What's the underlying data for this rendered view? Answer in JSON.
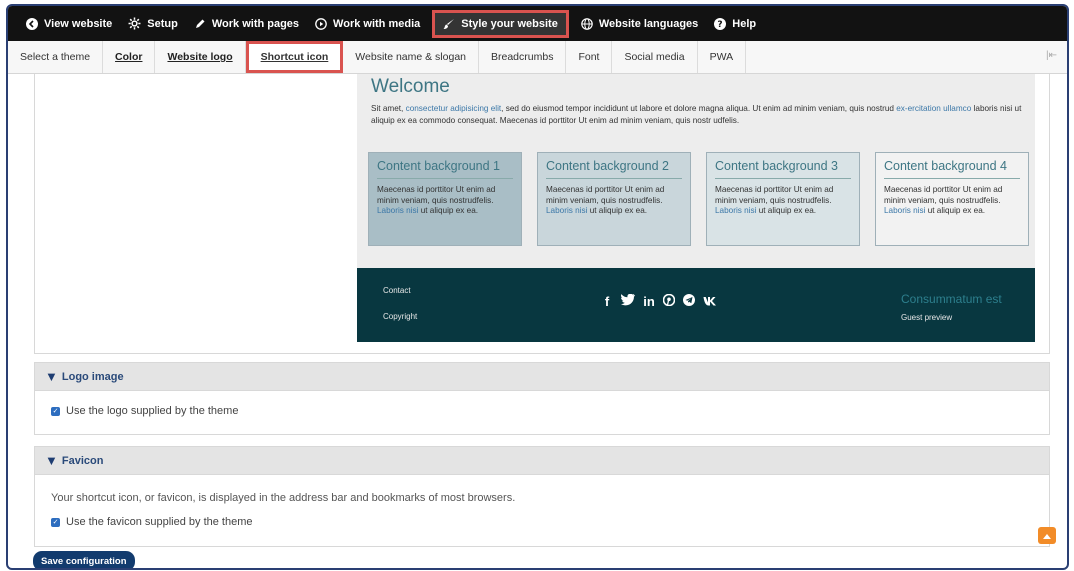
{
  "toolbar": {
    "items": [
      {
        "label": "View website",
        "icon": "arrow-circle-left-icon"
      },
      {
        "label": "Setup",
        "icon": "gear-icon"
      },
      {
        "label": "Work with pages",
        "icon": "pencil-icon"
      },
      {
        "label": "Work with media",
        "icon": "play-circle-icon"
      },
      {
        "label": "Style your website",
        "icon": "brush-icon"
      },
      {
        "label": "Website languages",
        "icon": "globe-icon"
      },
      {
        "label": "Help",
        "icon": "question-circle-icon"
      }
    ]
  },
  "tabs": {
    "items": [
      "Select a theme",
      "Color",
      "Website logo",
      "Shortcut icon",
      "Website name & slogan",
      "Breadcrumbs",
      "Font",
      "Social media",
      "PWA"
    ],
    "collapse_glyph": "|⇤"
  },
  "preview": {
    "title": "Welcome",
    "intro_a": "Sit amet, ",
    "intro_link1": "consectetur adipisicing elit",
    "intro_b": ", sed do eiusmod tempor incididunt ut labore et dolore magna aliqua. Ut enim ad minim veniam, quis nostrud ",
    "intro_link2": "ex-ercitation ullamco",
    "intro_c": " laboris nisi ut aliquip ex ea commodo consequat. Maecenas id porttitor Ut enim ad minim veniam, quis nostr udfelis.",
    "boxes": [
      {
        "title": "Content background 1",
        "bg": "#a9bec6"
      },
      {
        "title": "Content background 2",
        "bg": "#c9d6db"
      },
      {
        "title": "Content background 3",
        "bg": "#d9e3e6"
      },
      {
        "title": "Content background 4",
        "bg": "#f2f2f2"
      }
    ],
    "box_text_a": "Maecenas id porttitor Ut enim ad minim veniam, quis nostrudfelis. ",
    "box_link": "Laboris nisi",
    "box_text_b": " ut aliquip ex ea.",
    "footer": {
      "contact": "Contact",
      "copyright": "Copyright",
      "socials": [
        "f",
        "🐦",
        "in",
        "℗",
        "➤",
        "κ"
      ],
      "social_icons": [
        "facebook-icon",
        "twitter-icon",
        "linkedin-icon",
        "pinterest-icon",
        "telegram-icon",
        "vk-icon"
      ],
      "right_title": "Consummatum est",
      "right_sub": "Guest preview"
    }
  },
  "logo_section": {
    "title": "Logo image",
    "checkbox_label": "Use the logo supplied by the theme"
  },
  "favicon_section": {
    "title": "Favicon",
    "description": "Your shortcut icon, or favicon, is displayed in the address bar and bookmarks of most browsers.",
    "checkbox_label": "Use the favicon supplied by the theme"
  },
  "actions": {
    "save_label": "Save configuration"
  },
  "colors": {
    "toolbar_bg": "#121212",
    "highlight": "#d9534f",
    "footer_bg": "#083740",
    "accent": "#3e7684",
    "button": "#123b6e"
  }
}
